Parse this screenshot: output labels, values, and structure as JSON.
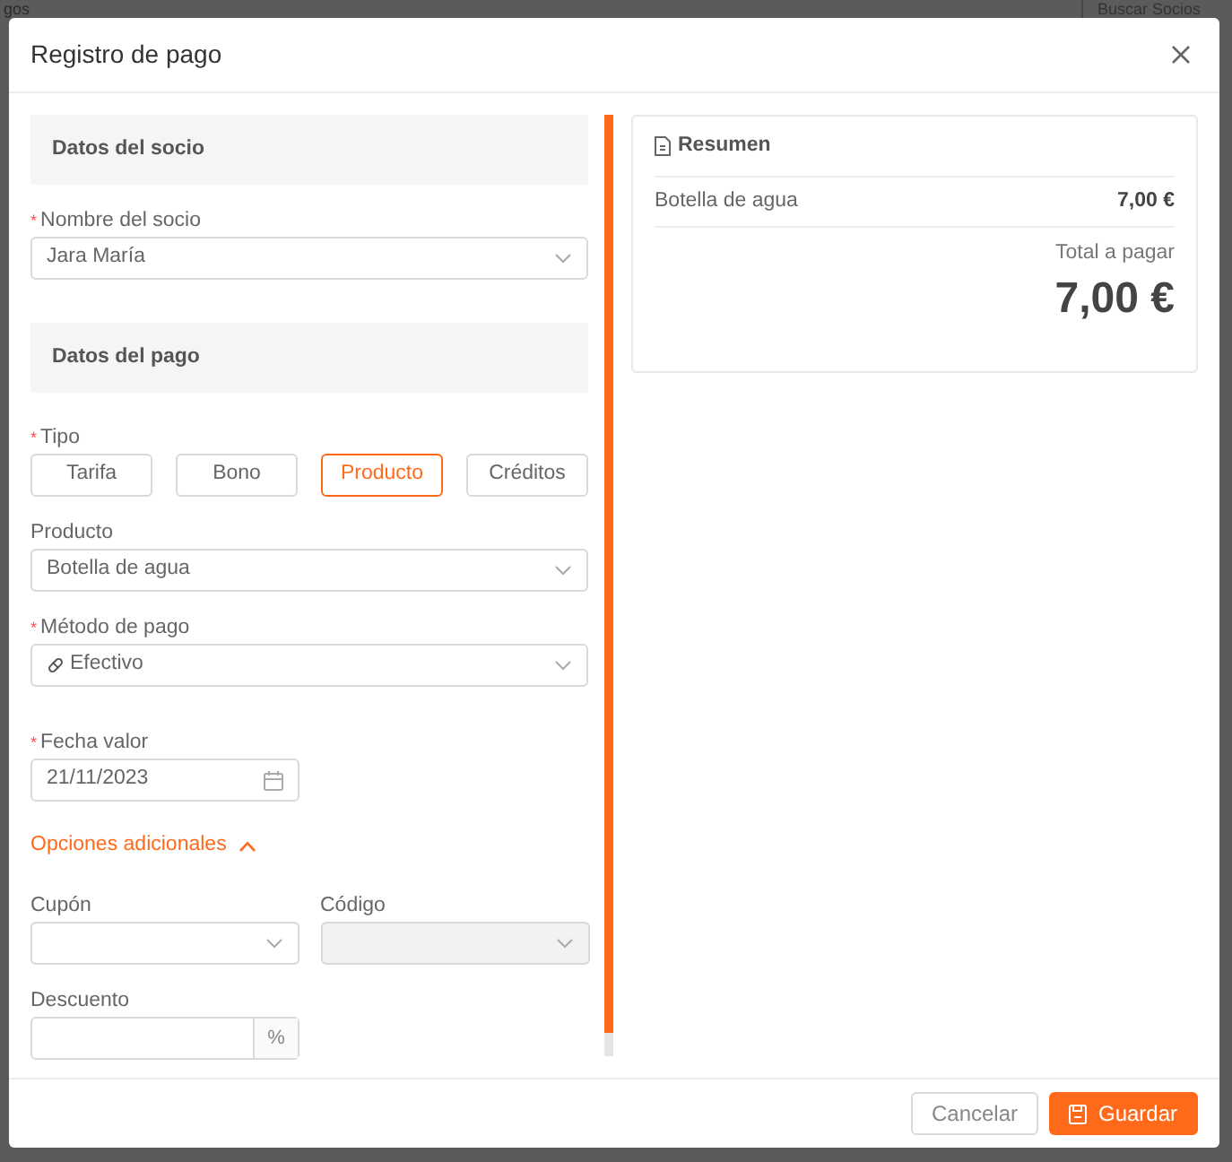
{
  "background": {
    "page_title": "gos",
    "search_placeholder": "Buscar Socios"
  },
  "dialog": {
    "title": "Registro de pago"
  },
  "required_mark": "*",
  "member_section": {
    "title": "Datos del socio"
  },
  "member_field": {
    "label": "Nombre del socio",
    "required": true,
    "value": "Jara María"
  },
  "payment_section": {
    "title": "Datos del pago"
  },
  "payment_type": {
    "label": "Tipo",
    "required": true,
    "options": [
      {
        "label": "Tarifa",
        "selected": false
      },
      {
        "label": "Bono",
        "selected": false
      },
      {
        "label": "Producto",
        "selected": true
      },
      {
        "label": "Créditos",
        "selected": false
      }
    ]
  },
  "product_field": {
    "label": "Producto",
    "required": false,
    "value": "Botella de agua"
  },
  "payment_method": {
    "label": "Método de pago",
    "required": true,
    "value": "Efectivo"
  },
  "value_date": {
    "label": "Fecha valor",
    "required": true,
    "value": "21/11/2023"
  },
  "more_options": {
    "label": "Opciones adicionales",
    "expanded": true
  },
  "coupon": {
    "label": "Cupón",
    "disabled": false
  },
  "code": {
    "label": "Código",
    "disabled": true
  },
  "discount": {
    "label": "Descuento",
    "suffix": "%"
  },
  "summary": {
    "title": "Resumen",
    "lines": [
      {
        "name": "Botella de agua",
        "amount": "7,00 €"
      }
    ],
    "total_label": "Total a pagar",
    "total": "7,00 €"
  },
  "buttons": [
    {
      "label": "Cancelar",
      "kind": "secondary"
    },
    {
      "label": "Guardar",
      "kind": "primary"
    }
  ]
}
